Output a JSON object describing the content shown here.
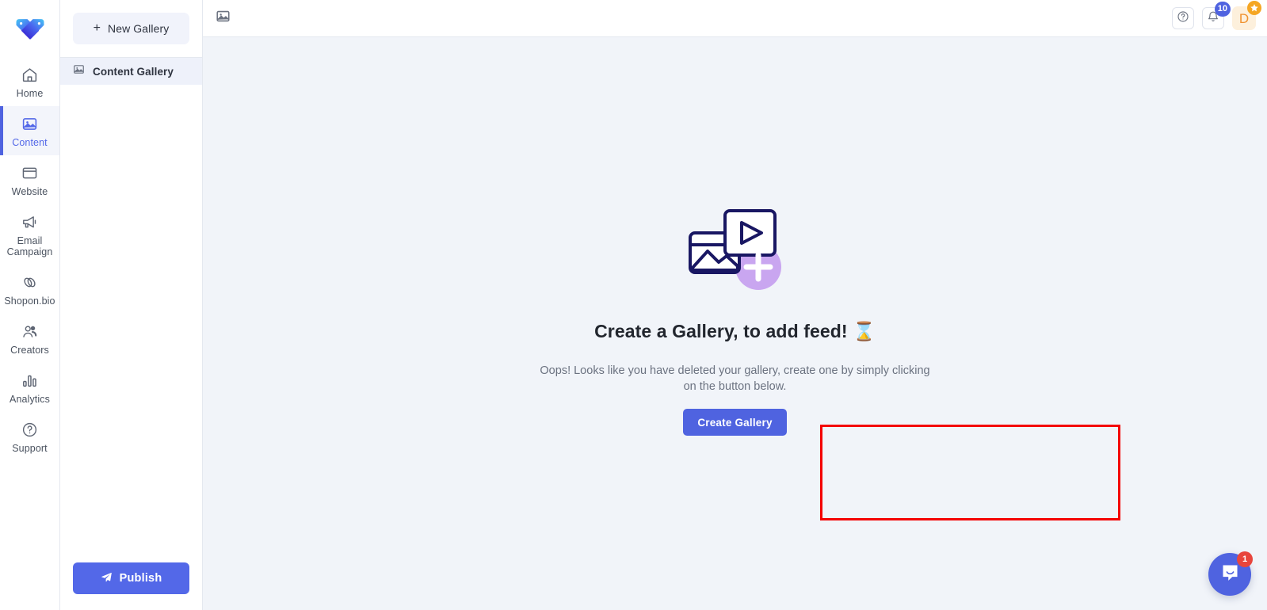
{
  "brand": {
    "logo_icon": "heart-tags-logo",
    "accent_color": "#4f63e0",
    "secondary_accent": "#5368e8"
  },
  "rail": {
    "items": [
      {
        "label": "Home",
        "icon": "home-icon",
        "active": false
      },
      {
        "label": "Content",
        "icon": "image-icon",
        "active": true
      },
      {
        "label": "Website",
        "icon": "browser-window-icon",
        "active": false
      },
      {
        "label": "Email Campaign",
        "icon": "megaphone-icon",
        "active": false
      },
      {
        "label": "Shopon.bio",
        "icon": "link-chain-icon",
        "active": false
      },
      {
        "label": "Creators",
        "icon": "people-icon",
        "active": false
      },
      {
        "label": "Analytics",
        "icon": "bar-chart-icon",
        "active": false
      },
      {
        "label": "Support",
        "icon": "question-circle-icon",
        "active": false
      }
    ]
  },
  "panel": {
    "new_gallery_label": "New Gallery",
    "new_gallery_plus": "+",
    "galleries": [
      {
        "label": "Content Gallery",
        "icon": "image-icon",
        "selected": true
      }
    ],
    "publish_label": "Publish",
    "publish_icon": "paper-plane-icon"
  },
  "topbar": {
    "left_icon": "image-icon",
    "help_icon": "question-circle-icon",
    "notification_icon": "bell-icon",
    "notification_count": "10",
    "avatar_letter": "D",
    "avatar_badge_icon": "star-icon"
  },
  "empty_state": {
    "illustration_icon": "add-media-illustration",
    "title": "Create a Gallery, to add feed! ⌛",
    "subtitle": "Oops! Looks like you have deleted your gallery, create one by simply clicking on the button below.",
    "cta_label": "Create Gallery"
  },
  "annotation": {
    "type": "highlight-rectangle",
    "color": "#f40000"
  },
  "chat": {
    "icon": "chat-bubble-smile-icon",
    "unread_count": "1"
  }
}
